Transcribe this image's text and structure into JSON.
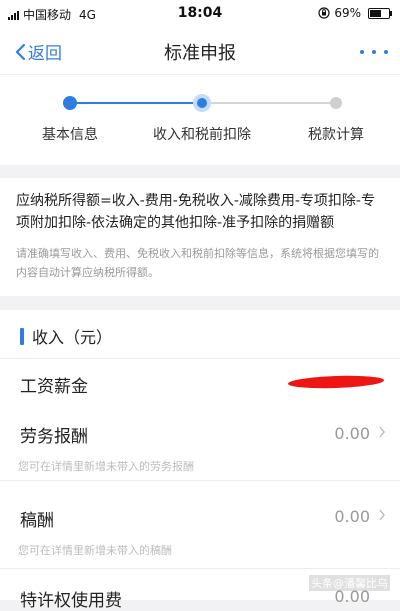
{
  "status_bar": {
    "carrier": "中国移动",
    "network": "4G",
    "time": "18:04",
    "battery_percent": "69%",
    "battery_level": 0.69
  },
  "nav": {
    "back_label": "返回",
    "title": "标准申报"
  },
  "steps": [
    {
      "label": "基本信息",
      "state": "done"
    },
    {
      "label": "收入和税前扣除",
      "state": "active"
    },
    {
      "label": "税款计算",
      "state": "pending"
    }
  ],
  "formula": {
    "text": "应纳税所得额=收入-费用-免税收入-减除费用-专项扣除-专项附加扣除-依法确定的其他扣除-准予扣除的捐赠额",
    "hint": "请准确填写收入、费用、免税收入和税前扣除等信息，系统将根据您填写的内容自动计算应纳税所得额。"
  },
  "income": {
    "title": "收入（元）",
    "rows": [
      {
        "label": "工资薪金",
        "value": "",
        "hint": ""
      },
      {
        "label": "劳务报酬",
        "value": "0.00",
        "hint": "您可在详情里新增未带入的劳务报酬"
      },
      {
        "label": "稿酬",
        "value": "0.00",
        "hint": "您可在详情里新增未带入的稿酬"
      },
      {
        "label": "特许权使用费",
        "value": "0.00",
        "hint": ""
      }
    ]
  },
  "watermark": "头条@潘馨比乌",
  "colors": {
    "accent": "#2f7de1",
    "inactive": "#cfcfcf",
    "redaction": "#ee1515"
  }
}
